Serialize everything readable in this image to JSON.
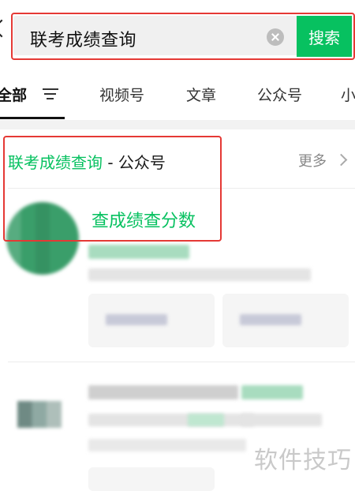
{
  "search": {
    "query": "联考成绩查询",
    "button_label": "搜索"
  },
  "tabs": [
    {
      "label": "全部",
      "active": true
    },
    {
      "label": "视频号"
    },
    {
      "label": "文章"
    },
    {
      "label": "公众号"
    },
    {
      "label": "小"
    }
  ],
  "section": {
    "title_highlight": "联考成绩查询",
    "title_suffix": " - 公众号",
    "more_label": "更多",
    "result_link": "查成绩查分数"
  },
  "watermark": "软件技巧",
  "colors": {
    "accent": "#07c160",
    "highlight_border": "#e53935"
  },
  "icons": {
    "back": "chevron-left-icon",
    "clear": "clear-icon",
    "filter": "filter-icon",
    "more": "chevron-right-icon"
  }
}
